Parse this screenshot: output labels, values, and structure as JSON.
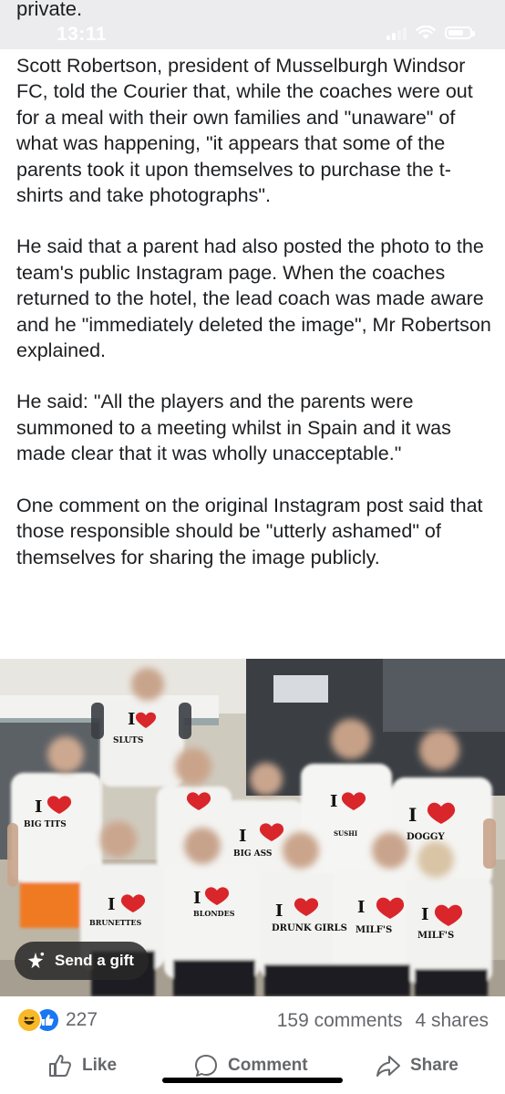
{
  "status_bar": {
    "cut_text": "private.",
    "time": "13:11"
  },
  "article": {
    "paragraphs": [
      "Scott Robertson, president of Musselburgh Windsor FC, told the Courier that, while the coaches were out for a meal with their own families and \"unaware\" of what was happening, \"it appears that some of the parents took it upon themselves to purchase the t-shirts and take photographs\".",
      "He said that a parent had also posted the photo to the team's public Instagram page. When the coaches returned to the hotel, the lead coach was made aware and he \"immediately deleted the image\", Mr Robertson explained.",
      "He said: \"All the players and the parents were summoned to a meeting whilst in Spain and it was made clear that it was wholly unacceptable.\"",
      "One comment on the original Instagram post said that those responsible should be \"utterly ashamed\" of themselves for sharing the image publicly."
    ]
  },
  "photo": {
    "shirt_texts": [
      "I",
      "SLUTS",
      "BIG TITS",
      "DRUNK GIRLS",
      "BLONDES",
      "BRUNETTES",
      "BIG ASS",
      "SUSHI",
      "DOGGY",
      "MILF'S",
      "MILF'S"
    ],
    "gift_button_label": "Send a gift"
  },
  "reactions": {
    "count": "227",
    "comments": "159 comments",
    "shares": "4 shares"
  },
  "actions": {
    "like": "Like",
    "comment": "Comment",
    "share": "Share"
  },
  "colors": {
    "like_blue": "#1877f2",
    "haha_yellow": "#f7b928",
    "muted_text": "#65676b",
    "heart_red": "#d9262b"
  }
}
